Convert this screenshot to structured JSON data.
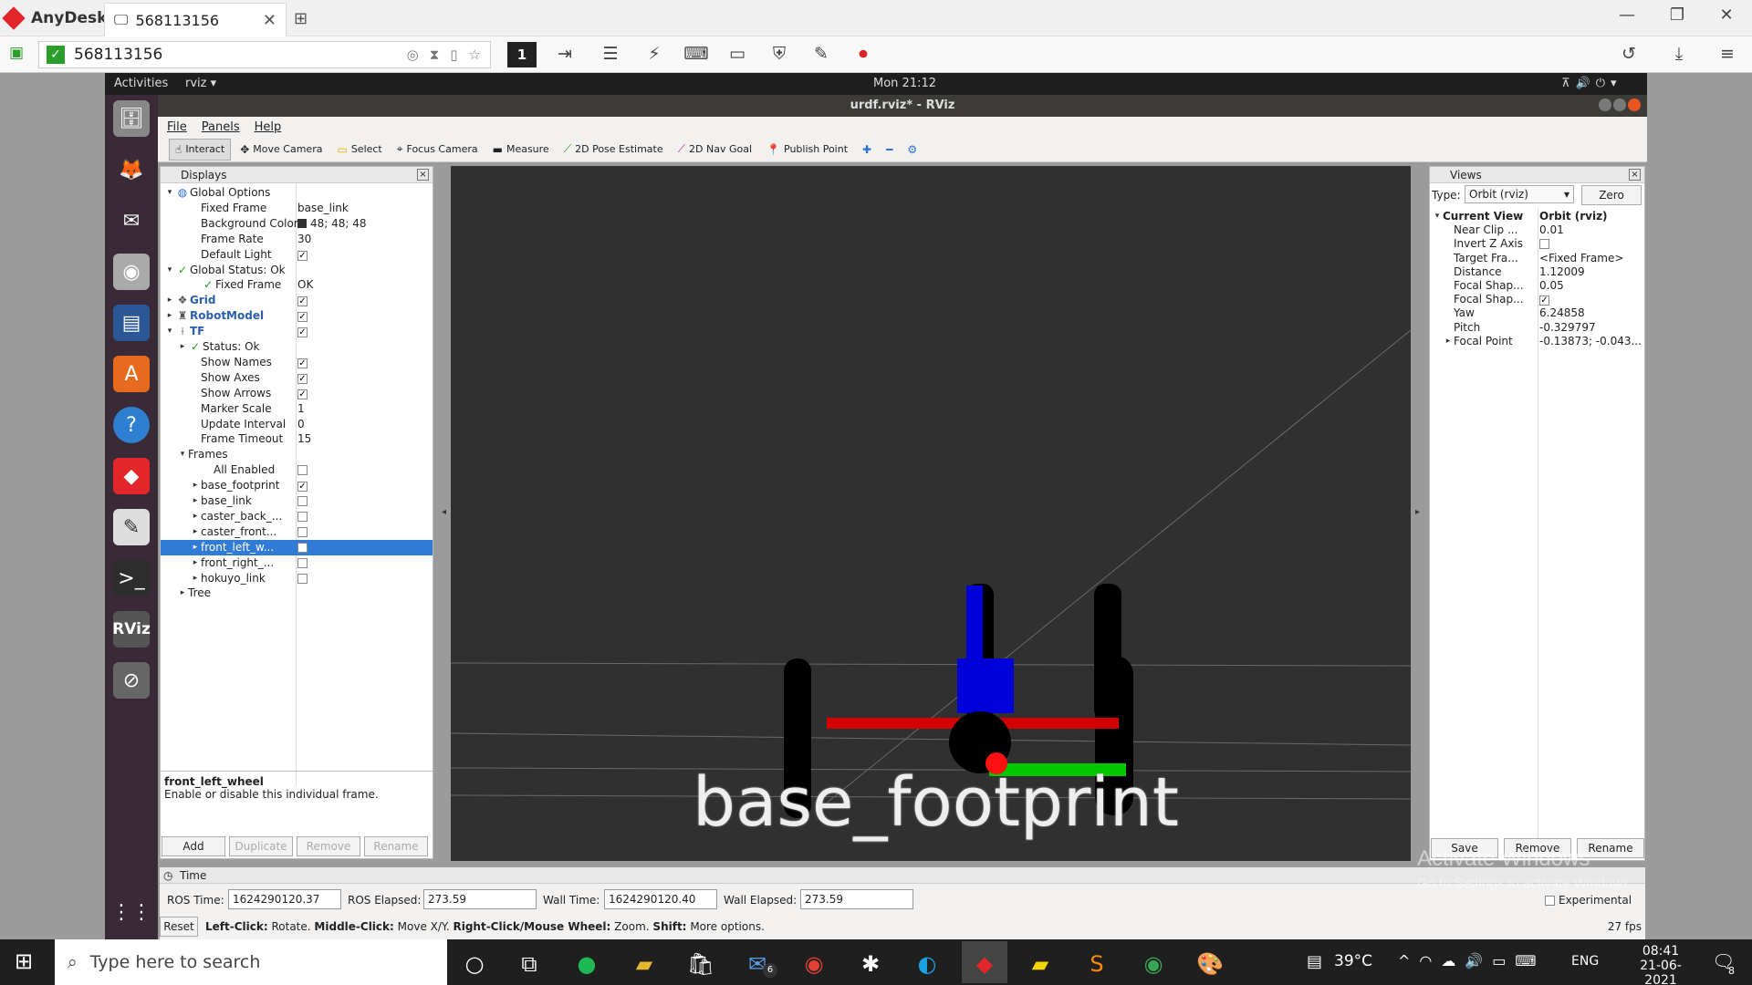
{
  "anydesk": {
    "app_name": "AnyDesk",
    "tab_title": "568113156",
    "address": "568113156",
    "display_number": "1"
  },
  "ubuntu": {
    "activities": "Activities",
    "app_menu": "rviz ▾",
    "clock": "Mon 21:12"
  },
  "rviz": {
    "window_title": "urdf.rviz* - RViz",
    "menu": [
      "File",
      "Panels",
      "Help"
    ],
    "tools": [
      "Interact",
      "Move Camera",
      "Select",
      "Focus Camera",
      "Measure",
      "2D Pose Estimate",
      "2D Nav Goal",
      "Publish Point"
    ],
    "displays_title": "Displays",
    "displays_rows": [
      {
        "indent": 0,
        "arrow": "▾",
        "icon": "globe",
        "label": "Global Options",
        "value": ""
      },
      {
        "indent": 2,
        "arrow": "",
        "icon": "",
        "label": "Fixed Frame",
        "value": "base_link"
      },
      {
        "indent": 2,
        "arrow": "",
        "icon": "",
        "label": "Background Color",
        "value": "48; 48; 48"
      },
      {
        "indent": 2,
        "arrow": "",
        "icon": "",
        "label": "Frame Rate",
        "value": "30"
      },
      {
        "indent": 2,
        "arrow": "",
        "icon": "",
        "label": "Default Light",
        "value": "✓"
      },
      {
        "indent": 0,
        "arrow": "▾",
        "icon": "check",
        "label": "Global Status: Ok",
        "value": ""
      },
      {
        "indent": 2,
        "arrow": "",
        "icon": "check",
        "label": "Fixed Frame",
        "value": "OK"
      },
      {
        "indent": 0,
        "arrow": "▸",
        "icon": "grid",
        "label": "Grid",
        "value": "✓"
      },
      {
        "indent": 0,
        "arrow": "▸",
        "icon": "robot",
        "label": "RobotModel",
        "value": "✓"
      },
      {
        "indent": 0,
        "arrow": "▾",
        "icon": "tf",
        "label": "TF",
        "value": "✓"
      },
      {
        "indent": 1,
        "arrow": "▸",
        "icon": "check",
        "label": "Status: Ok",
        "value": ""
      },
      {
        "indent": 2,
        "arrow": "",
        "icon": "",
        "label": "Show Names",
        "value": "✓"
      },
      {
        "indent": 2,
        "arrow": "",
        "icon": "",
        "label": "Show Axes",
        "value": "✓"
      },
      {
        "indent": 2,
        "arrow": "",
        "icon": "",
        "label": "Show Arrows",
        "value": "✓"
      },
      {
        "indent": 2,
        "arrow": "",
        "icon": "",
        "label": "Marker Scale",
        "value": "1"
      },
      {
        "indent": 2,
        "arrow": "",
        "icon": "",
        "label": "Update Interval",
        "value": "0"
      },
      {
        "indent": 2,
        "arrow": "",
        "icon": "",
        "label": "Frame Timeout",
        "value": "15"
      },
      {
        "indent": 1,
        "arrow": "▾",
        "icon": "",
        "label": "Frames",
        "value": ""
      },
      {
        "indent": 3,
        "arrow": "",
        "icon": "",
        "label": "All Enabled",
        "value": ""
      },
      {
        "indent": 2,
        "arrow": "▸",
        "icon": "",
        "label": "base_footprint",
        "value": "✓"
      },
      {
        "indent": 2,
        "arrow": "▸",
        "icon": "",
        "label": "base_link",
        "value": ""
      },
      {
        "indent": 2,
        "arrow": "▸",
        "icon": "",
        "label": "caster_back_...",
        "value": ""
      },
      {
        "indent": 2,
        "arrow": "▸",
        "icon": "",
        "label": "caster_front...",
        "value": ""
      },
      {
        "indent": 2,
        "arrow": "▸",
        "icon": "",
        "label": "front_left_w...",
        "value": "",
        "selected": true
      },
      {
        "indent": 2,
        "arrow": "▸",
        "icon": "",
        "label": "front_right_...",
        "value": ""
      },
      {
        "indent": 2,
        "arrow": "▸",
        "icon": "",
        "label": "hokuyo_link",
        "value": ""
      },
      {
        "indent": 1,
        "arrow": "▸",
        "icon": "",
        "label": "Tree",
        "value": ""
      }
    ],
    "description_title": "front_left_wheel",
    "description_text": "Enable or disable this individual frame.",
    "display_buttons": [
      "Add",
      "Duplicate",
      "Remove",
      "Rename"
    ],
    "viewport_label": "base_footprint",
    "views_title": "Views",
    "views_type_label": "Type:",
    "views_type_value": "Orbit (rviz)",
    "views_zero": "Zero",
    "views_rows": [
      {
        "indent": 0,
        "arrow": "▾",
        "label": "Current View",
        "value": "Orbit (rviz)",
        "bold": true
      },
      {
        "indent": 1,
        "arrow": "",
        "label": "Near Clip ...",
        "value": "0.01"
      },
      {
        "indent": 1,
        "arrow": "",
        "label": "Invert Z Axis",
        "value": ""
      },
      {
        "indent": 1,
        "arrow": "",
        "label": "Target Fra...",
        "value": "<Fixed Frame>"
      },
      {
        "indent": 1,
        "arrow": "",
        "label": "Distance",
        "value": "1.12009"
      },
      {
        "indent": 1,
        "arrow": "",
        "label": "Focal Shap...",
        "value": "0.05"
      },
      {
        "indent": 1,
        "arrow": "",
        "label": "Focal Shap...",
        "value": "✓"
      },
      {
        "indent": 1,
        "arrow": "",
        "label": "Yaw",
        "value": "6.24858"
      },
      {
        "indent": 1,
        "arrow": "",
        "label": "Pitch",
        "value": "-0.329797"
      },
      {
        "indent": 1,
        "arrow": "▸",
        "label": "Focal Point",
        "value": "-0.13873; -0.043..."
      }
    ],
    "views_buttons": [
      "Save",
      "Remove",
      "Rename"
    ],
    "time_title": "Time",
    "ros_time_label": "ROS Time:",
    "ros_time": "1624290120.37",
    "ros_elapsed_label": "ROS Elapsed:",
    "ros_elapsed": "273.59",
    "wall_time_label": "Wall Time:",
    "wall_time": "1624290120.40",
    "wall_elapsed_label": "Wall Elapsed:",
    "wall_elapsed": "273.59",
    "experimental": "Experimental",
    "reset": "Reset",
    "status_left_click": "Left-Click:",
    "status_rotate": "Rotate.",
    "status_middle_click": "Middle-Click:",
    "status_move": "Move X/Y.",
    "status_right_click": "Right-Click/Mouse Wheel:",
    "status_zoom": "Zoom.",
    "status_shift": "Shift:",
    "status_more": "More options.",
    "fps": "27 fps"
  },
  "windows": {
    "activate_title": "Activate Windows",
    "activate_sub": "Go to Settings to activate Windows.",
    "search_placeholder": "Type here to search",
    "temperature": "39°C",
    "language": "ENG",
    "time": "08:41",
    "date": "21-06-2021",
    "notification_count": "8",
    "mail_badge": "6"
  },
  "colors": {
    "viewport_bg": "#303030",
    "selection": "#2f7bd6",
    "dock_bg": "#3a2a37",
    "anydesk_red": "#e3262a"
  }
}
